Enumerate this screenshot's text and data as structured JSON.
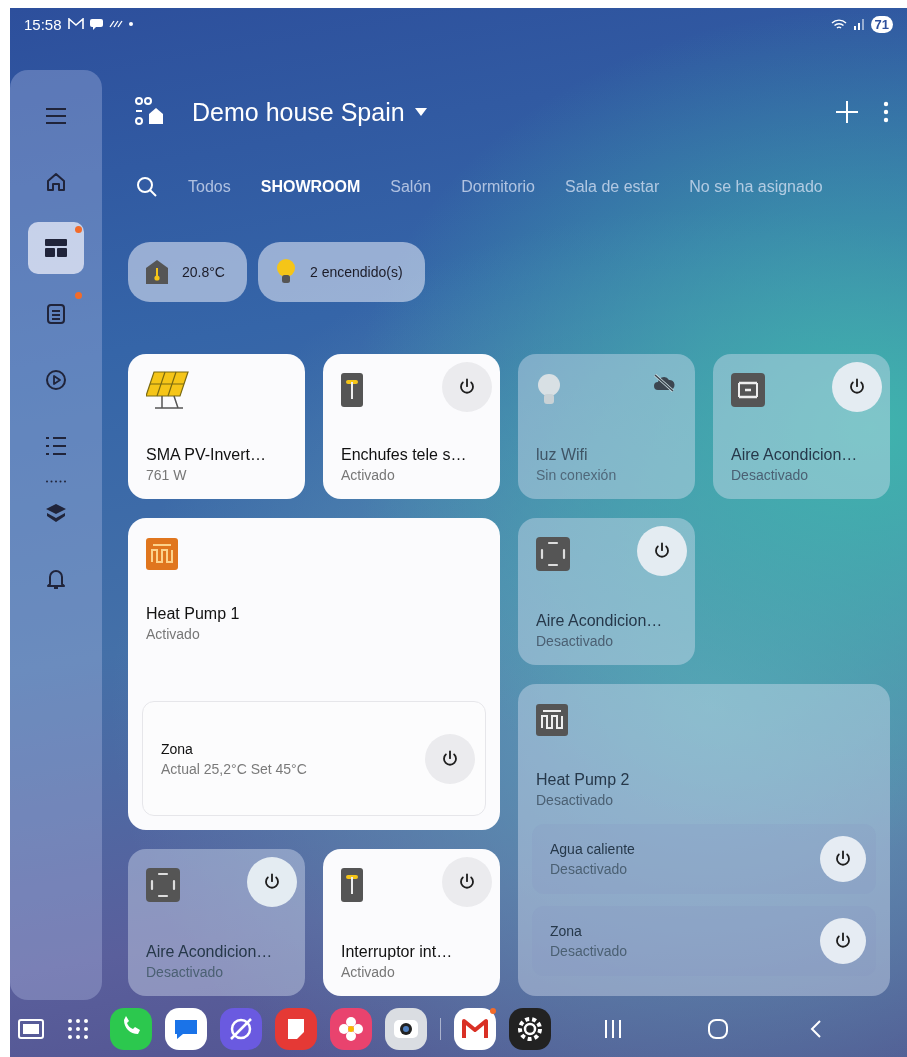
{
  "status_bar": {
    "time": "15:58",
    "battery": "71"
  },
  "sidebar": {
    "items": [
      {
        "selected": false,
        "badge": false
      },
      {
        "selected": false,
        "badge": false
      },
      {
        "selected": true,
        "badge": true
      },
      {
        "selected": false,
        "badge": true
      },
      {
        "selected": false,
        "badge": false
      },
      {
        "selected": false,
        "badge": false
      },
      {
        "selected": false,
        "badge": false
      },
      {
        "selected": false,
        "badge": false
      }
    ]
  },
  "header": {
    "title": "Demo house Spain"
  },
  "tabs": [
    {
      "label": "Todos",
      "selected": false
    },
    {
      "label": "SHOWROOM",
      "selected": true
    },
    {
      "label": "Salón",
      "selected": false
    },
    {
      "label": "Dormitorio",
      "selected": false
    },
    {
      "label": "Sala de estar",
      "selected": false
    },
    {
      "label": "No se ha asignado",
      "selected": false
    }
  ],
  "chips": [
    {
      "kind": "temperature",
      "label": "20.8°C"
    },
    {
      "kind": "light",
      "label": "2 encendido(s)"
    }
  ],
  "tiles": [
    {
      "kind": "solar",
      "name": "SMA PV-Invert…",
      "status": "761 W",
      "on": true,
      "connected": true,
      "power": false
    },
    {
      "kind": "plug",
      "name": "Enchufes tele s…",
      "status": "Activado",
      "on": true,
      "connected": true,
      "power": true
    },
    {
      "kind": "bulb",
      "name": "luz Wifi",
      "status": "Sin conexión",
      "on": false,
      "connected": false
    },
    {
      "kind": "ac_bar",
      "name": "Aire Acondicion…",
      "status": "Desactivado",
      "on": false,
      "connected": true,
      "power": true
    },
    {
      "kind": "heatpump",
      "name": "Heat Pump 1",
      "status": "Activado",
      "on": true,
      "connected": true,
      "power": false,
      "zones": [
        {
          "name": "Zona",
          "status": "Actual 25,2°C Set 45°C"
        }
      ]
    },
    {
      "kind": "ac_frame",
      "name": "Aire Acondicion…",
      "status": "Desactivado",
      "on": false,
      "connected": true,
      "power": true
    },
    {
      "kind": "heatpump",
      "name": "Heat Pump 2",
      "status": "Desactivado",
      "on": false,
      "connected": true,
      "power": false,
      "zones": [
        {
          "name": "Agua caliente",
          "status": "Desactivado"
        },
        {
          "name": "Zona",
          "status": "Desactivado"
        }
      ]
    },
    {
      "kind": "ac_frame",
      "name": "Aire Acondicion…",
      "status": "Desactivado",
      "on": false,
      "connected": true,
      "power": true
    },
    {
      "kind": "plug",
      "name": "Interruptor int…",
      "status": "Activado",
      "on": true,
      "connected": true,
      "power": true
    }
  ]
}
